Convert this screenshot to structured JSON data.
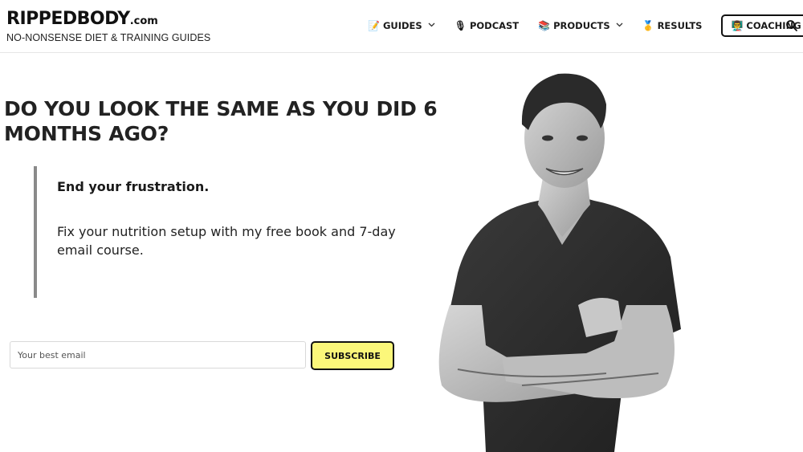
{
  "header": {
    "logo_text": "RIPPEDBODY",
    "logo_suffix": ".com",
    "tagline": "NO-NONSENSE DIET & TRAINING GUIDES"
  },
  "nav": {
    "items": [
      {
        "label": "GUIDES",
        "icon": "memo-icon",
        "glyph": "📝",
        "has_dropdown": true
      },
      {
        "label": "PODCAST",
        "icon": "microphone-icon",
        "glyph": "🎙",
        "has_dropdown": false
      },
      {
        "label": "PRODUCTS",
        "icon": "books-icon",
        "glyph": "📚",
        "has_dropdown": true
      },
      {
        "label": "RESULTS",
        "icon": "medal-icon",
        "glyph": "🥇",
        "has_dropdown": false
      },
      {
        "label": "COACHING",
        "icon": "coach-person-icon",
        "glyph": "👨‍🏫",
        "has_dropdown": false
      }
    ],
    "search_icon": "search-icon"
  },
  "hero": {
    "headline": "DO YOU LOOK THE SAME AS YOU DID 6 MONTHS AGO?",
    "quote_lead": "End your frustration.",
    "quote_body": "Fix your nutrition setup with my free book and 7-day email course.",
    "email_placeholder": "Your best email",
    "subscribe_label": "SUBSCRIBE"
  },
  "colors": {
    "subscribe_bg": "#fbf77a",
    "quote_border": "#8a8a8a",
    "text": "#1a1a1a"
  }
}
